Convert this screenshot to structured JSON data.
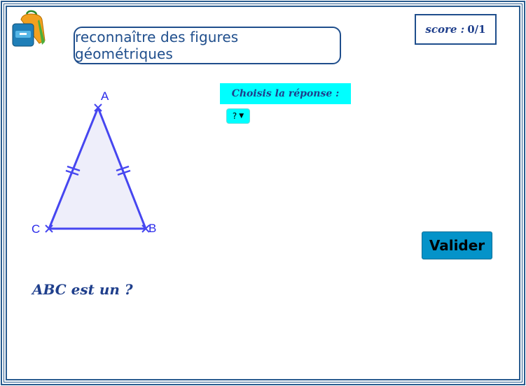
{
  "header": {
    "title": "reconnaître des figures géométriques",
    "score_label": "score :",
    "score_value": "0/1",
    "logo_icon": "backpack-icon"
  },
  "question_panel": {
    "prompt": "Choisis la réponse :",
    "selected_value": "?",
    "dropdown_icon": "caret-down-icon"
  },
  "figure": {
    "vertices": [
      "A",
      "B",
      "C"
    ],
    "edge_color": "#4646f0",
    "fill_color": "#eeeefa"
  },
  "question": {
    "text": "ABC est un ?"
  },
  "actions": {
    "validate_label": "Valider"
  },
  "colors": {
    "frame": "#2a5c8f",
    "accent_cyan": "#00ffff",
    "button": "#0493c9",
    "text_blue": "#1f3f8c"
  }
}
